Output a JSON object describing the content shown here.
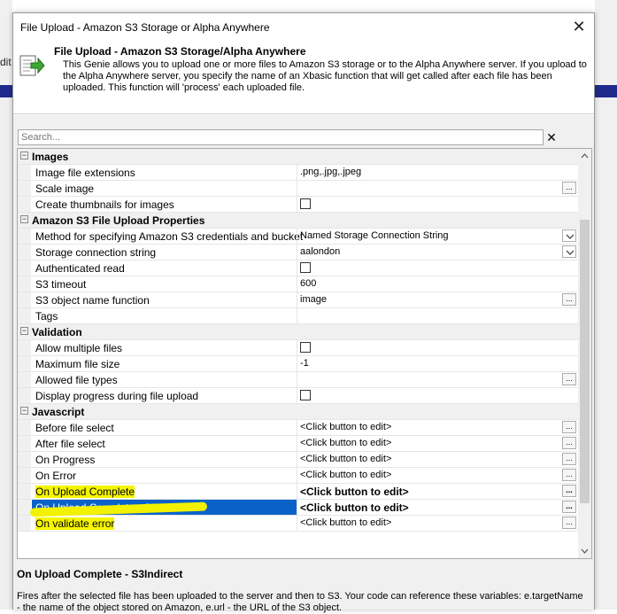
{
  "background_app": {
    "partial_label": "dit"
  },
  "window": {
    "title": "File Upload - Amazon S3 Storage or Alpha Anywhere",
    "close_glyph": "✕"
  },
  "header": {
    "title": "File Upload - Amazon S3 Storage/Alpha Anywhere",
    "description": "This Genie allows you to upload one or more files to Amazon S3 storage or to the Alpha Anywhere server. If you upload to the Alpha Anywhere server, you specify the name of an Xbasic function that will get called after each file has been uploaded. This function will 'process' each uploaded file."
  },
  "search": {
    "placeholder": "Search...",
    "clear_glyph": "✕"
  },
  "property_grid": {
    "categories": [
      {
        "label": "Images",
        "toggle": "−"
      },
      {
        "label": "Amazon S3 File Upload Properties",
        "toggle": "−"
      },
      {
        "label": "Validation",
        "toggle": "−"
      },
      {
        "label": "Javascript",
        "toggle": "−"
      }
    ],
    "images": [
      {
        "name": "Image file extensions",
        "value": ".png,.jpg,.jpeg"
      },
      {
        "name": "Scale image",
        "value": "",
        "button": "..."
      },
      {
        "name": "Create thumbnails for images",
        "checkbox": false
      }
    ],
    "s3": [
      {
        "name": "Method for specifying Amazon S3 credentials and bucket",
        "value": "Named Storage Connection String"
      },
      {
        "name": "Storage connection string",
        "value": "aalondon"
      },
      {
        "name": "Authenticated read",
        "checkbox": false
      },
      {
        "name": "S3 timeout",
        "value": "600"
      },
      {
        "name": "S3 object name function",
        "value": "image",
        "button": "..."
      },
      {
        "name": "Tags",
        "value": ""
      }
    ],
    "validation": [
      {
        "name": "Allow multiple files",
        "checkbox": false
      },
      {
        "name": "Maximum file size",
        "value": "-1"
      },
      {
        "name": "Allowed file types",
        "value": "",
        "button": "..."
      },
      {
        "name": "Display progress during file upload",
        "checkbox": false
      }
    ],
    "javascript": [
      {
        "name": "Before file select",
        "value": "<Click button to edit>",
        "button": "..."
      },
      {
        "name": "After file select",
        "value": "<Click button to edit>",
        "button": "..."
      },
      {
        "name": "On Progress",
        "value": "<Click button to edit>",
        "button": "..."
      },
      {
        "name": "On Error",
        "value": "<Click button to edit>",
        "button": "..."
      },
      {
        "name": "On Upload Complete",
        "value": "<Click button to edit>",
        "button": "..."
      },
      {
        "name": "On Upload Complete - S3Indirect",
        "value": "<Click button to edit>",
        "button": "..."
      },
      {
        "name": "On validate error",
        "value": "<Click button to edit>",
        "button": "..."
      }
    ]
  },
  "description_panel": {
    "title": "On Upload Complete - S3Indirect",
    "text": "Fires after the selected file has been uploaded to the server and then to S3. Your code can reference these variables: e.targetName - the name of the object stored on Amazon, e.url - the URL of the S3 object."
  },
  "colors": {
    "selection": "#0a62c9",
    "highlight": "#f5f500",
    "background_accent": "#1f2a8c"
  }
}
